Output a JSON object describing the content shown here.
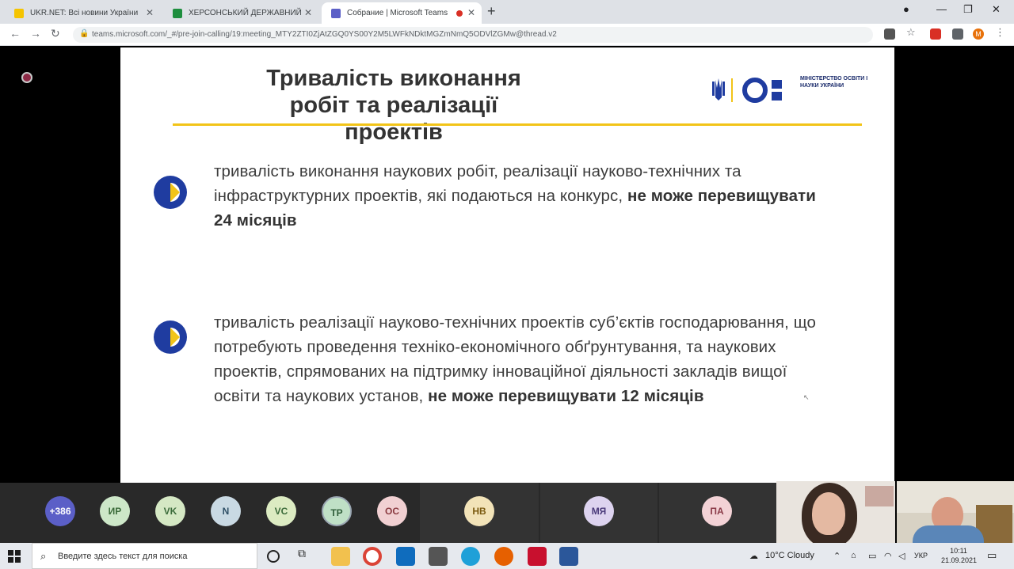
{
  "browser": {
    "tabs": [
      {
        "title": "UKR.NET: Всі новини України",
        "favicon_color": "#f5c400"
      },
      {
        "title": "ХЕРСОНСЬКИЙ ДЕРЖАВНИЙ",
        "favicon_color": "#1e8e3e"
      },
      {
        "title": "Собрание | Microsoft Teams",
        "favicon_color": "#5b5fc7"
      }
    ],
    "url": "teams.microsoft.com/_#/pre-join-calling/19:meeting_MTY2ZTI0ZjAtZGQ0YS00Y2M5LWFkNDktMGZmNmQ5ODVlZGMw@thread.v2",
    "profile_initial": "M"
  },
  "slide": {
    "title": "Тривалість виконання робіт та реалізації проектів",
    "logo_text": "МІНІСТЕРСТВО ОСВІТИ І НАУКИ УКРАЇНИ",
    "bullet1_text": "тривалість виконання наукових робіт, реалізації науково-технічних та інфраструктурних проектів, які подаються на конкурс, ",
    "bullet1_bold": "не може перевищувати 24 місяців",
    "bullet2_text": "тривалість реалізації науково-технічних проектів суб’єктів господарювання, що потребують проведення техніко-економічного обґрунтування, та наукових проектів, спрямованих на підтримку інноваційної діяльності закладів вищої освіти та наукових установ, ",
    "bullet2_bold": "не може перевищувати 12 місяців"
  },
  "participants": {
    "overflow": "+386",
    "avatars": [
      "ИР",
      "VK",
      "N",
      "VC",
      "TP",
      "OC",
      "НВ",
      "МЯ",
      "ПА"
    ]
  },
  "taskbar": {
    "search_placeholder": "Введите здесь текст для поиска",
    "weather": "10°C  Cloudy",
    "language": "УКР",
    "time": "10:11",
    "date": "21.09.2021"
  }
}
